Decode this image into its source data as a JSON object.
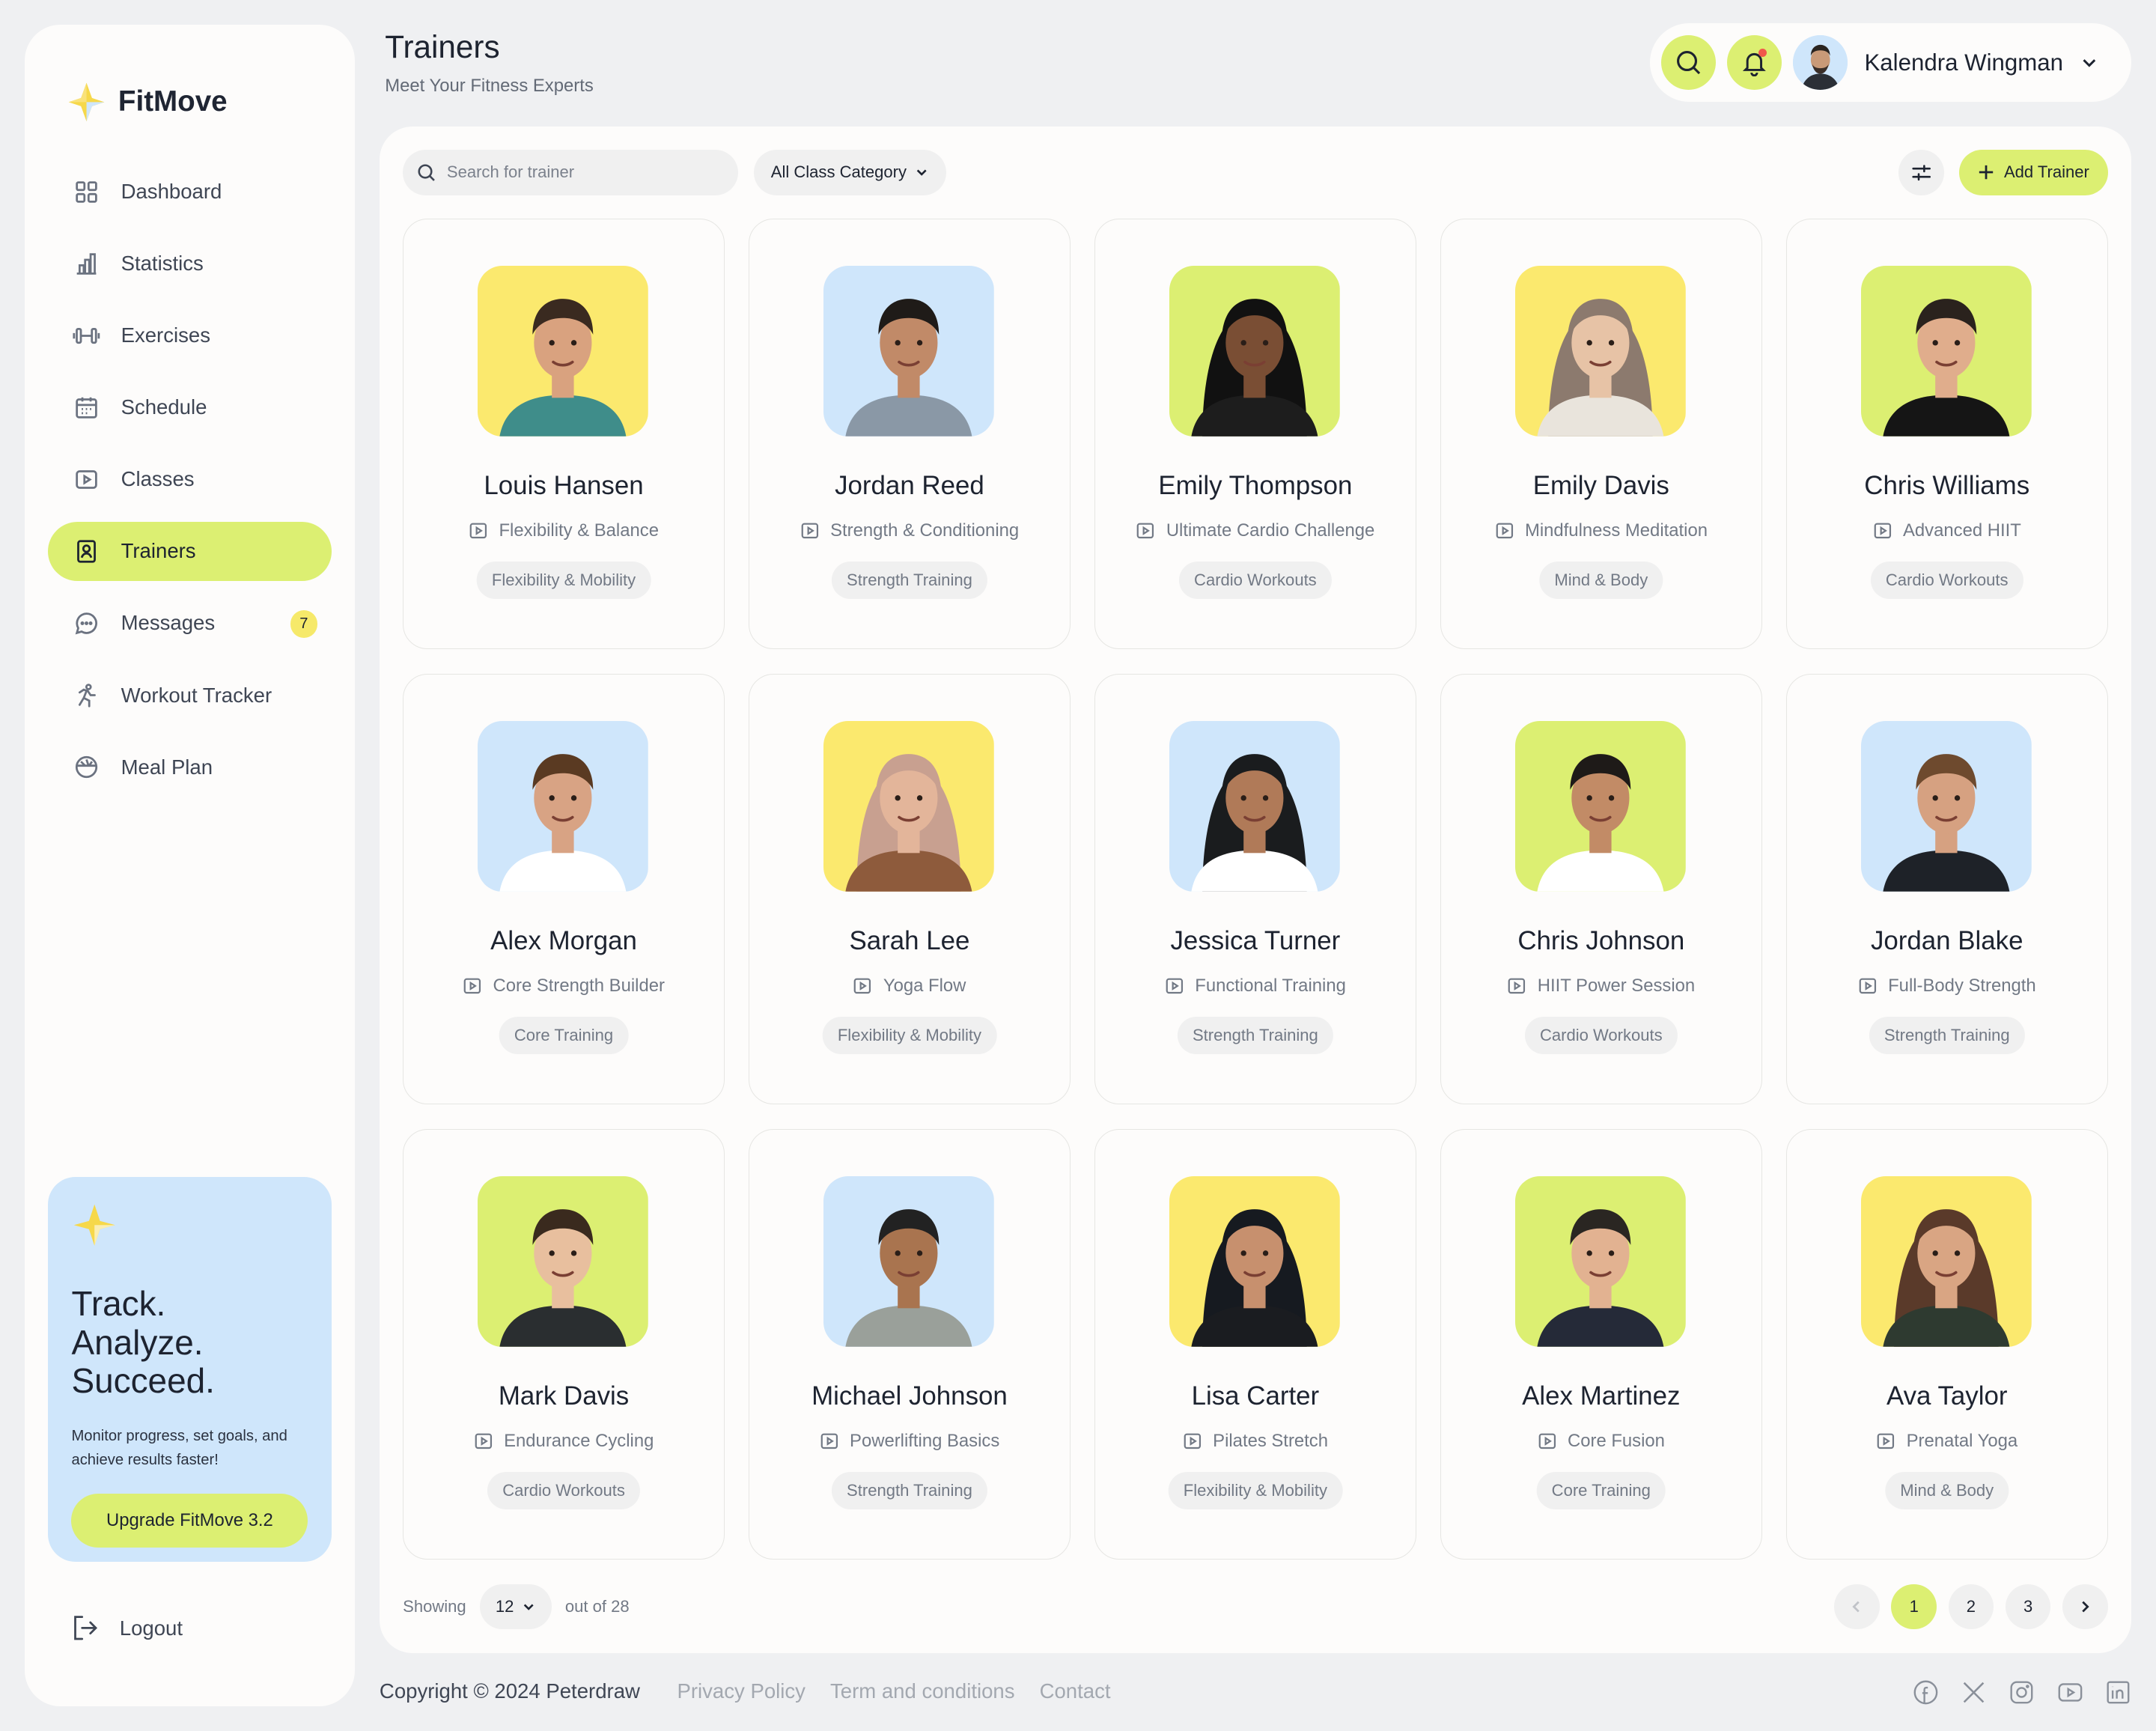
{
  "brand": {
    "name": "FitMove"
  },
  "nav": {
    "items": [
      {
        "label": "Dashboard",
        "icon": "grid-icon"
      },
      {
        "label": "Statistics",
        "icon": "bar-chart-icon"
      },
      {
        "label": "Exercises",
        "icon": "dumbbell-icon"
      },
      {
        "label": "Schedule",
        "icon": "calendar-icon"
      },
      {
        "label": "Classes",
        "icon": "play-icon"
      },
      {
        "label": "Trainers",
        "icon": "badge-icon",
        "active": true
      },
      {
        "label": "Messages",
        "icon": "chat-icon",
        "badge": "7"
      },
      {
        "label": "Workout Tracker",
        "icon": "running-icon"
      },
      {
        "label": "Meal Plan",
        "icon": "bowl-icon"
      }
    ],
    "logout": "Logout"
  },
  "promo": {
    "line1": "Track.",
    "line2": "Analyze.",
    "line3": "Succeed.",
    "text": "Monitor progress, set goals, and achieve results faster!",
    "button": "Upgrade FitMove 3.2"
  },
  "header": {
    "title": "Trainers",
    "subtitle": "Meet Your Fitness Experts",
    "user_name": "Kalendra Wingman"
  },
  "toolbar": {
    "search_placeholder": "Search for trainer",
    "category": "All Class Category",
    "add_label": "Add Trainer"
  },
  "trainers": [
    {
      "name": "Louis Hansen",
      "class": "Flexibility & Balance",
      "tag": "Flexibility & Mobility",
      "bg": "#fbe96e"
    },
    {
      "name": "Jordan Reed",
      "class": "Strength & Conditioning",
      "tag": "Strength Training",
      "bg": "#cfe6fb"
    },
    {
      "name": "Emily Thompson",
      "class": "Ultimate Cardio Challenge",
      "tag": "Cardio Workouts",
      "bg": "#dcef72"
    },
    {
      "name": "Emily Davis",
      "class": "Mindfulness Meditation",
      "tag": "Mind & Body",
      "bg": "#fbe96e"
    },
    {
      "name": "Chris Williams",
      "class": "Advanced HIIT",
      "tag": "Cardio Workouts",
      "bg": "#dcef72"
    },
    {
      "name": "Alex Morgan",
      "class": "Core Strength Builder",
      "tag": "Core Training",
      "bg": "#cfe6fb"
    },
    {
      "name": "Sarah Lee",
      "class": "Yoga Flow",
      "tag": "Flexibility & Mobility",
      "bg": "#fbe96e"
    },
    {
      "name": "Jessica Turner",
      "class": "Functional Training",
      "tag": "Strength Training",
      "bg": "#cfe6fb"
    },
    {
      "name": "Chris Johnson",
      "class": "HIIT Power Session",
      "tag": "Cardio Workouts",
      "bg": "#dcef72"
    },
    {
      "name": "Jordan Blake",
      "class": "Full-Body Strength",
      "tag": "Strength Training",
      "bg": "#cfe6fb"
    },
    {
      "name": "Mark Davis",
      "class": "Endurance Cycling",
      "tag": "Cardio Workouts",
      "bg": "#dcef72"
    },
    {
      "name": "Michael Johnson",
      "class": "Powerlifting Basics",
      "tag": "Strength Training",
      "bg": "#cfe6fb"
    },
    {
      "name": "Lisa Carter",
      "class": "Pilates Stretch",
      "tag": "Flexibility & Mobility",
      "bg": "#fbe96e"
    },
    {
      "name": "Alex Martinez",
      "class": "Core Fusion",
      "tag": "Core Training",
      "bg": "#dcef72"
    },
    {
      "name": "Ava Taylor",
      "class": "Prenatal Yoga",
      "tag": "Mind & Body",
      "bg": "#fbe96e"
    }
  ],
  "pagination": {
    "showing_label": "Showing",
    "per_page": "12",
    "total_label": "out of 28",
    "pages": [
      "1",
      "2",
      "3"
    ],
    "current": "1"
  },
  "footer": {
    "copyright": "Copyright © 2024 Peterdraw",
    "links": [
      "Privacy Policy",
      "Term and conditions",
      "Contact"
    ],
    "socials": [
      "facebook-icon",
      "x-icon",
      "instagram-icon",
      "youtube-icon",
      "linkedin-icon"
    ]
  },
  "colors": {
    "accent": "#dcef72",
    "blue": "#cfe6fb",
    "yellow": "#fbe96e",
    "background": "#eff0f2"
  }
}
